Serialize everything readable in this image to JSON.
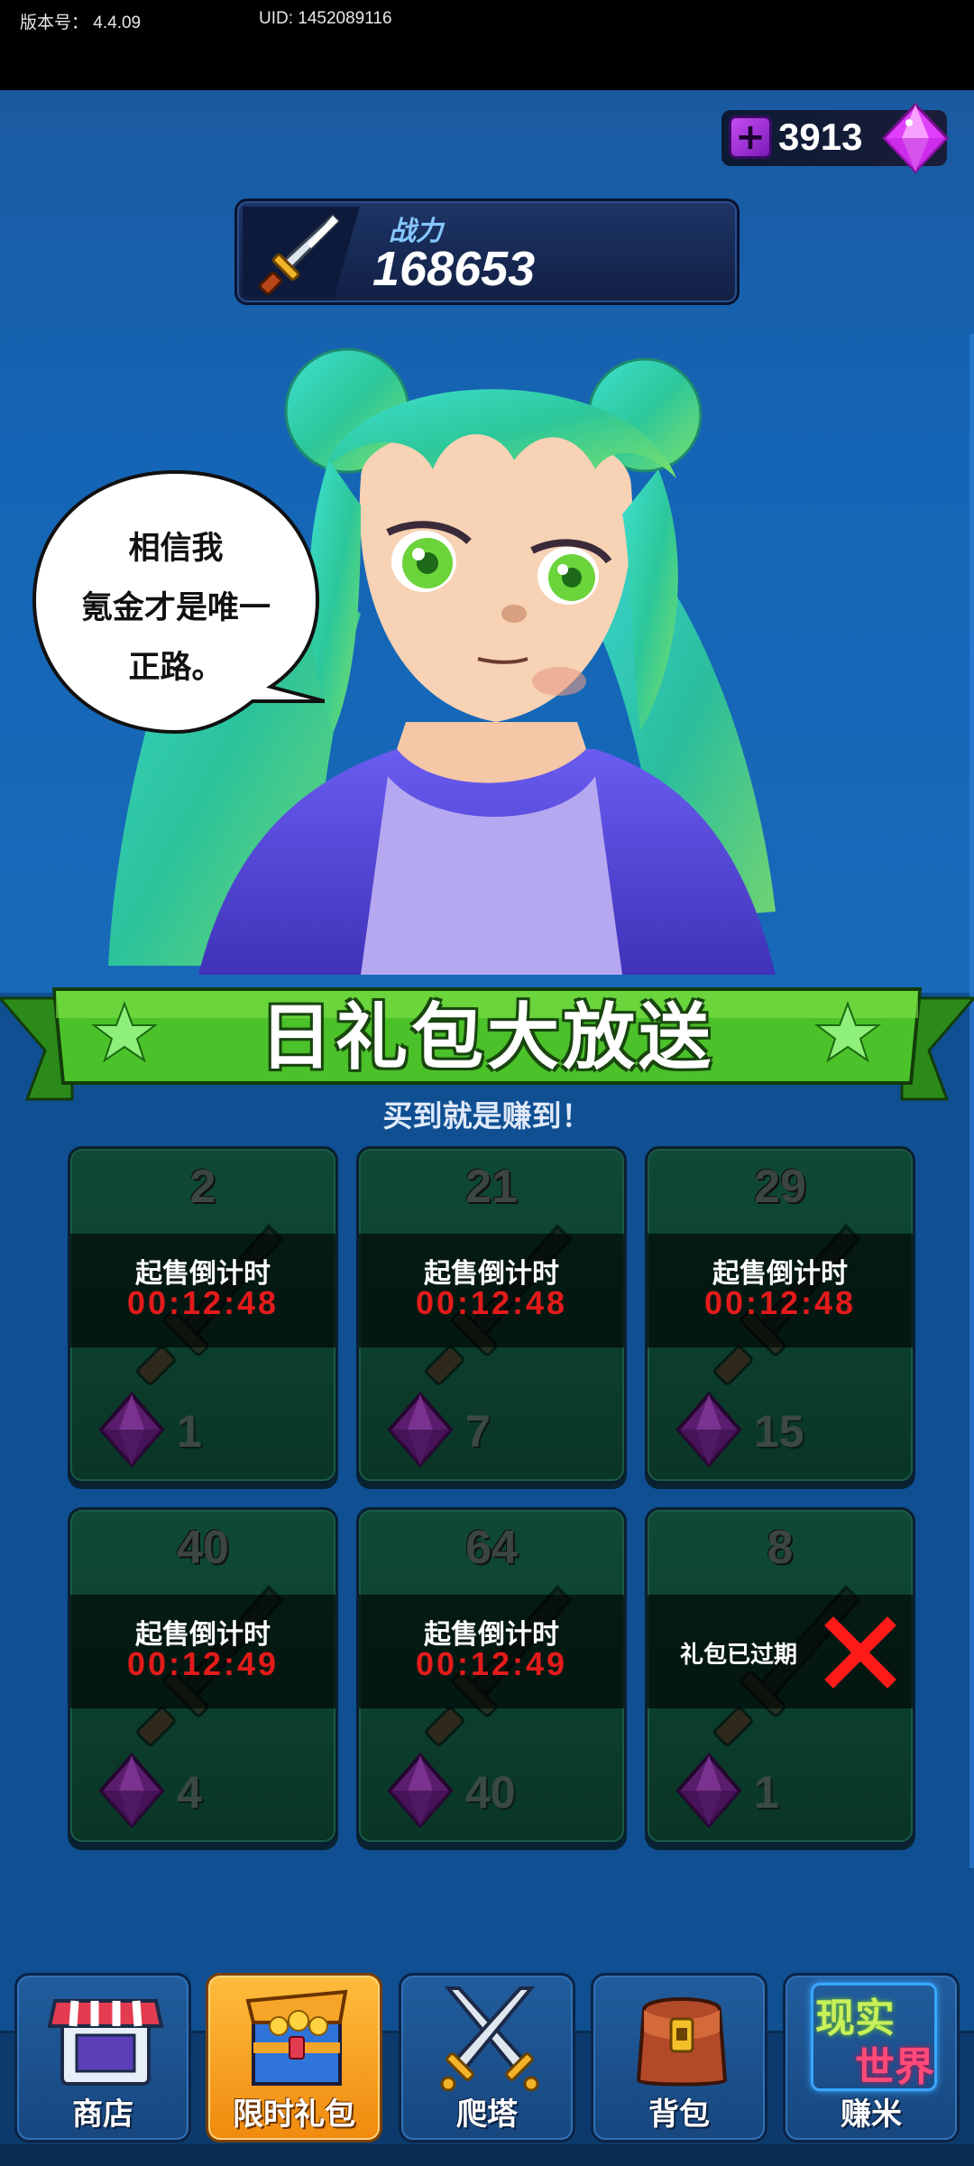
{
  "status_bar": {
    "version": "版本号： 4.4.09",
    "uid": "UID: 1452089116"
  },
  "currency": {
    "gems": "3913",
    "plus_icon": "plus-icon",
    "gem_icon": "gem-icon",
    "gem_color": "#e040fb"
  },
  "power": {
    "label": "战力",
    "value": "168653",
    "icon": "sword-icon"
  },
  "character": {
    "speech": [
      "相信我",
      "氪金才是唯一",
      "正路。"
    ]
  },
  "event": {
    "title": "日礼包大放送",
    "subtitle": "买到就是赚到！"
  },
  "packs": [
    {
      "number": "2",
      "status_label": "起售倒计时",
      "time": "00:12:48",
      "price": "1",
      "expired": false
    },
    {
      "number": "21",
      "status_label": "起售倒计时",
      "time": "00:12:48",
      "price": "7",
      "expired": false
    },
    {
      "number": "29",
      "status_label": "起售倒计时",
      "time": "00:12:48",
      "price": "15",
      "expired": false
    },
    {
      "number": "40",
      "status_label": "起售倒计时",
      "time": "00:12:49",
      "price": "4",
      "expired": false
    },
    {
      "number": "64",
      "status_label": "起售倒计时",
      "time": "00:12:49",
      "price": "40",
      "expired": false
    },
    {
      "number": "8",
      "status_label": "礼包已过期",
      "time": "",
      "price": "1",
      "expired": true
    }
  ],
  "nav": [
    {
      "label": "商店",
      "icon": "shop-icon",
      "active": false
    },
    {
      "label": "限时礼包",
      "icon": "treasure-chest-icon",
      "active": true
    },
    {
      "label": "爬塔",
      "icon": "crossed-swords-icon",
      "active": false
    },
    {
      "label": "背包",
      "icon": "backpack-icon",
      "active": false
    },
    {
      "label": "赚米",
      "icon": "real-world-icon",
      "active": false,
      "icon_text": [
        "现实",
        "世界"
      ]
    }
  ],
  "colors": {
    "background": "#0f4f92",
    "countdown": "#e31b1b",
    "banner_green": "#4cc22a",
    "active_tab": "#f7a528"
  }
}
